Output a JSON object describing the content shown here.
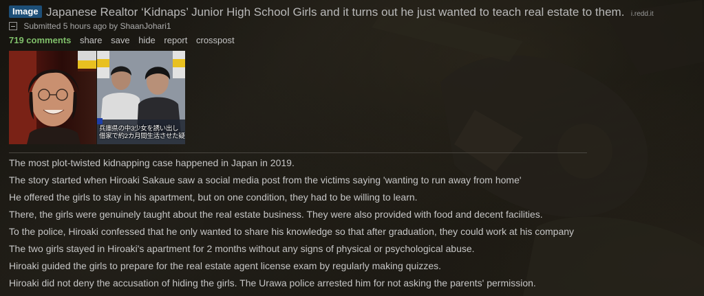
{
  "post": {
    "flair": "Image",
    "title": "Japanese Realtor ‘Kidnaps’ Junior High School Girls and it turns out he just wanted to teach real estate to them.",
    "domain": "i.redd.it",
    "submitted_prefix": "Submitted",
    "time_ago": "5 hours ago",
    "by": "by",
    "author": "ShaanJohari1",
    "actions": {
      "comments": "719 comments",
      "share": "share",
      "save": "save",
      "hide": "hide",
      "report": "report",
      "crosspost": "crosspost"
    },
    "image": {
      "caption_line1": "兵庫県の中3少女を誘い出し",
      "caption_line2": "借家で約2カ月間生活させた疑"
    },
    "body": [
      "The most plot-twisted kidnapping case happened in Japan in 2019.",
      "The story started when Hiroaki Sakaue saw a social media post from the victims saying 'wanting to run away from home'",
      "He offered the girls to stay in his apartment, but on one condition, they had to be willing to learn.",
      "There, the girls were genuinely taught about the real estate business. They were also provided with food and decent facilities.",
      "To the police, Hiroaki confessed that he only wanted to share his knowledge so that after graduation, they could work at his company",
      "The two girls stayed in Hiroaki's apartment for 2 months without any signs of physical or psychological abuse.",
      "Hiroaki guided the girls to prepare for the real estate agent license exam by regularly making quizzes.",
      "Hiroaki did not deny the accusation of hiding the girls. The Urawa police arrested him for not asking the parents' permission."
    ]
  },
  "colors": {
    "flair_bg": "#1d4f78",
    "comments_link": "#7fbf6a",
    "title_text": "#b9b9b9",
    "background": "#1a1813"
  }
}
